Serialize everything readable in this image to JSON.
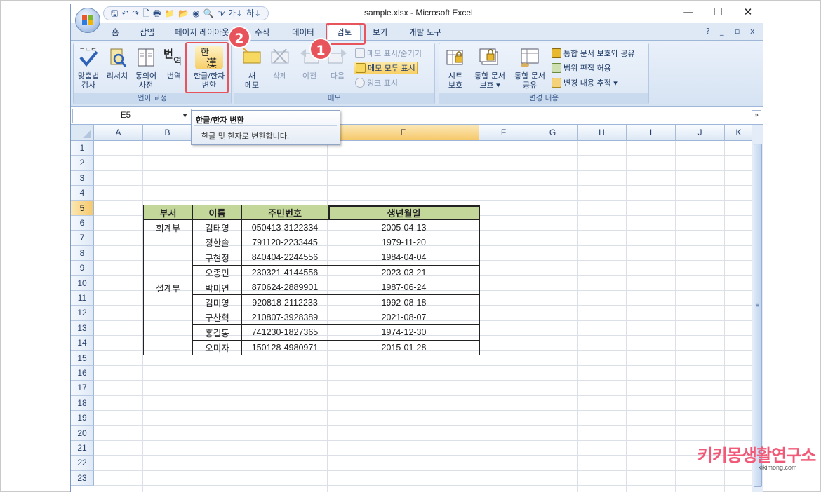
{
  "window": {
    "title": "sample.xlsx - Microsoft Excel",
    "minimize": "—",
    "maximize": "☐",
    "close": "✕"
  },
  "qat": {
    "items": [
      "🖫",
      "↶",
      "↷",
      "🗋",
      "🖶",
      "📁",
      "📂",
      "◉",
      "🔍",
      "ᵃ𝑣",
      "가↓",
      "하↓"
    ]
  },
  "tabs": [
    "홈",
    "삽입",
    "페이지 레이아웃",
    "수식",
    "데이터",
    "검토",
    "보기",
    "개발 도구"
  ],
  "active_tab": "검토",
  "mdi_controls": [
    "?",
    "_",
    "▫",
    "x"
  ],
  "ribbon": {
    "groups": {
      "proofing": {
        "label": "언어 교정",
        "buttons": [
          {
            "label": "맞춤법\n검사"
          },
          {
            "label": "리서치"
          },
          {
            "label": "동의어\n사전"
          },
          {
            "label": "번역"
          },
          {
            "label": "한글/한자\n변환",
            "icon_text": "한\n漢"
          }
        ]
      },
      "comments": {
        "label": "메모",
        "buttons": [
          {
            "label": "새\n메모"
          },
          {
            "label": "삭제"
          },
          {
            "label": "이전"
          },
          {
            "label": "다음"
          }
        ],
        "small": [
          "메모 표시/숨기기",
          "메모 모두 표시",
          "잉크 표시"
        ]
      },
      "changes": {
        "label": "변경 내용",
        "buttons": [
          {
            "label": "시트\n보호"
          },
          {
            "label": "통합 문서\n보호 ▾"
          },
          {
            "label": "통합 문서\n공유"
          }
        ],
        "small": [
          "통합 문서 보호와 공유",
          "범위 편집 허용",
          "변경 내용 추적 ▾"
        ]
      }
    }
  },
  "annotations": {
    "badge1": "1",
    "badge2": "2"
  },
  "formula_bar": {
    "name_box": "E5"
  },
  "tooltip": {
    "title": "한글/한자 변환",
    "description": "한글 및 한자로 변환합니다."
  },
  "columns": [
    "A",
    "B",
    "C",
    "D",
    "E",
    "F",
    "G",
    "H",
    "I",
    "J",
    "K"
  ],
  "rows": [
    "1",
    "2",
    "3",
    "4",
    "5",
    "6",
    "7",
    "8",
    "9",
    "10",
    "11",
    "12",
    "13",
    "14",
    "15",
    "16",
    "17",
    "18",
    "19",
    "20",
    "21",
    "22",
    "23"
  ],
  "selected_cell": "E5",
  "table": {
    "headers": [
      "부서",
      "이름",
      "주민번호",
      "생년월일"
    ],
    "rows": [
      [
        "회계부",
        "김태영",
        "050413-3122334",
        "2005-04-13"
      ],
      [
        "",
        "정한솔",
        "791120-2233445",
        "1979-11-20"
      ],
      [
        "",
        "구현정",
        "840404-2244556",
        "1984-04-04"
      ],
      [
        "",
        "오종민",
        "230321-4144556",
        "2023-03-21"
      ],
      [
        "설계부",
        "박미연",
        "870624-2889901",
        "1987-06-24"
      ],
      [
        "",
        "김미영",
        "920818-2112233",
        "1992-08-18"
      ],
      [
        "",
        "구찬혁",
        "210807-3928389",
        "2021-08-07"
      ],
      [
        "",
        "홍길동",
        "741230-1827365",
        "1974-12-30"
      ],
      [
        "",
        "오미자",
        "150128-4980971",
        "2015-01-28"
      ]
    ]
  },
  "watermark": {
    "main": "키키몽생활연구소",
    "sub": "kikimong.com"
  },
  "colors": {
    "header_fill": "#c4d79b",
    "highlight": "#e8545c",
    "ribbon_bg": "#dfe9f5"
  }
}
